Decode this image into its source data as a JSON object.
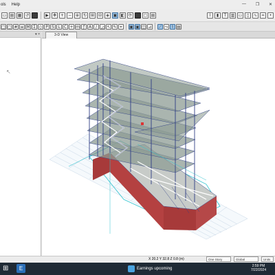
{
  "menu": {
    "tools_fragment": "ols",
    "help": "Help"
  },
  "panel": {
    "pin": "▾ ×"
  },
  "tab": {
    "label": "3-D View",
    "close": "×"
  },
  "status": {
    "coords": "X 20.2  Y 32.8  Z 0.8 (m)",
    "story": "One Story",
    "system": "Global",
    "units": "Units"
  },
  "taskbar": {
    "earnings": "Earnings upcoming",
    "time": "2:59 PM",
    "date": "7/22/2024"
  },
  "colors": {
    "slab": "#8e9c94",
    "frame": "#2f3d86",
    "wall": "#a73a3a",
    "grid": "#c6d6e6",
    "cyan": "#2fc3cf"
  }
}
